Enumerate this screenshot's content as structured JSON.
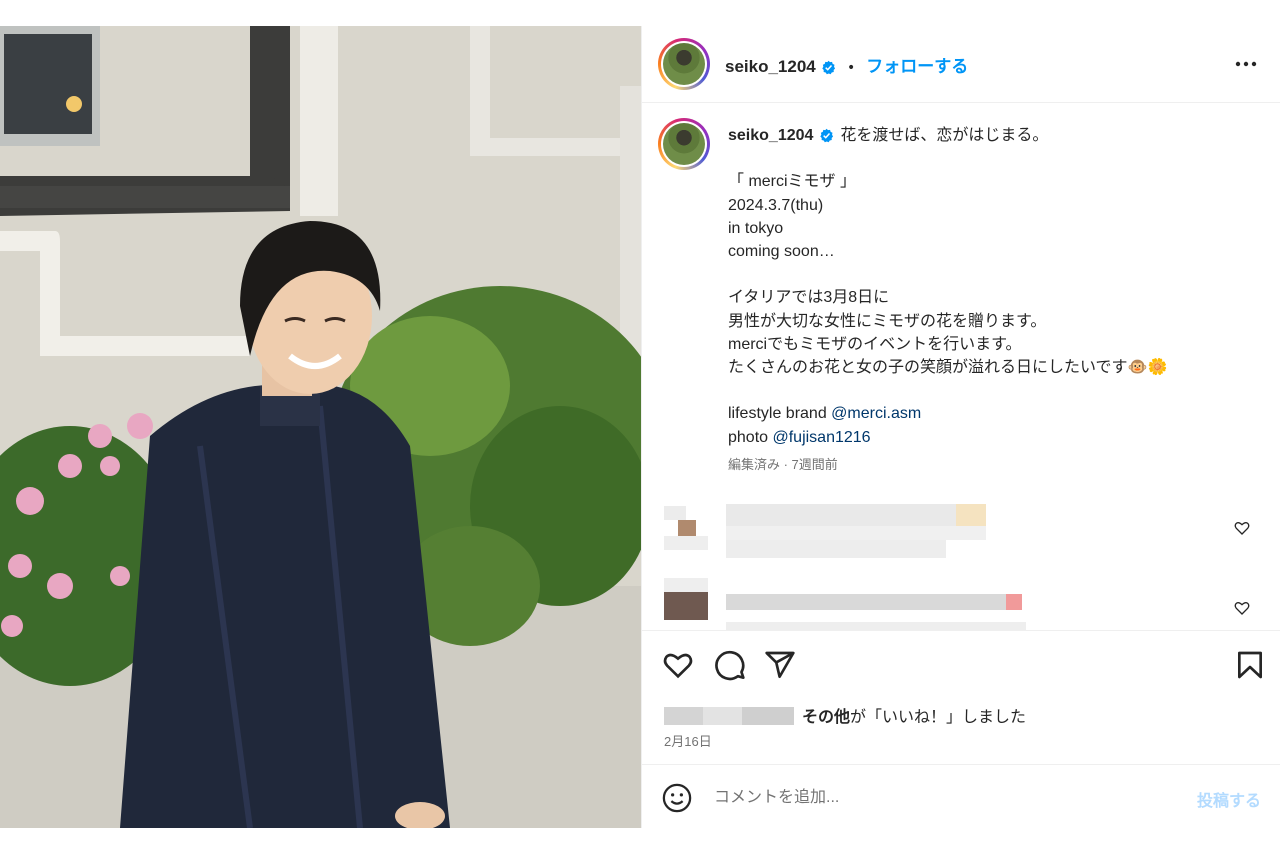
{
  "header": {
    "username": "seiko_1204",
    "separator": "•",
    "follow_label": "フォローする"
  },
  "caption": {
    "username": "seiko_1204",
    "first_line": "花を渡せば、恋がはじまる。",
    "lines": [
      "",
      "「 merciミモザ 」",
      "2024.3.7(thu)",
      "in tokyo",
      "coming soon…",
      "",
      "イタリアでは3月8日に",
      "男性が大切な女性にミモザの花を贈ります。",
      "merciでもミモザのイベントを行います。",
      "たくさんのお花と女の子の笑顔が溢れる日にしたいです🐵🌼",
      ""
    ],
    "brand_prefix": "lifestyle brand ",
    "brand_link": "@merci.asm",
    "photo_prefix": "photo ",
    "photo_link": "@fujisan1216",
    "meta": "編集済み · 7週間前"
  },
  "likes": {
    "suffix_bold": "その他",
    "suffix_text": "が「いいね！」しました"
  },
  "date": "2月16日",
  "comment": {
    "placeholder": "コメントを追加...",
    "post_label": "投稿する"
  },
  "colors": {
    "accent": "#0095f6",
    "link": "#00376b",
    "muted": "#737373",
    "post_disabled": "#b3dbff"
  },
  "icons": [
    "verified-badge-icon",
    "more-options-icon",
    "heart-icon",
    "comment-icon",
    "share-icon",
    "bookmark-icon",
    "emoji-icon"
  ]
}
